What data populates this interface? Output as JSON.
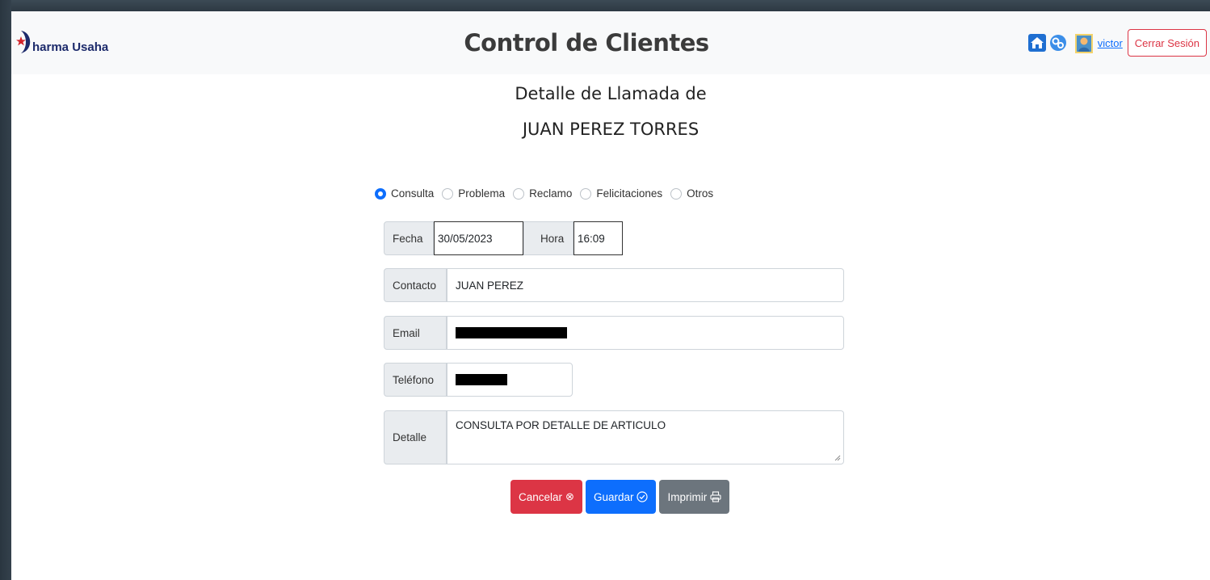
{
  "header": {
    "logo_text": "harma Usaha",
    "title": "Control de Clientes",
    "icons": [
      "home-icon",
      "settings-icon",
      "user-icon"
    ],
    "user_name": " victor",
    "logout_label": "Cerrar Sesión"
  },
  "detail": {
    "heading": "Detalle de Llamada de",
    "client_name": "JUAN PEREZ TORRES"
  },
  "call_type": {
    "options": [
      "Consulta",
      "Problema",
      "Reclamo",
      "Felicitaciones",
      "Otros"
    ],
    "selected": "Consulta"
  },
  "form": {
    "fecha_label": "Fecha",
    "fecha_value": "30/05/2023",
    "hora_label": "Hora",
    "hora_value": "16:09",
    "contacto_label": "Contacto",
    "contacto_value": "JUAN PEREZ",
    "email_label": "Email",
    "telefono_label": "Teléfono",
    "detalle_label": "Detalle",
    "detalle_value": "CONSULTA POR DETALLE DE ARTICULO"
  },
  "buttons": {
    "cancel_label": "Cancelar",
    "save_label": "Guardar",
    "print_label": "Imprimir"
  },
  "colors": {
    "danger": "#dc3545",
    "primary": "#0d6efd",
    "secondary": "#6c757d"
  }
}
